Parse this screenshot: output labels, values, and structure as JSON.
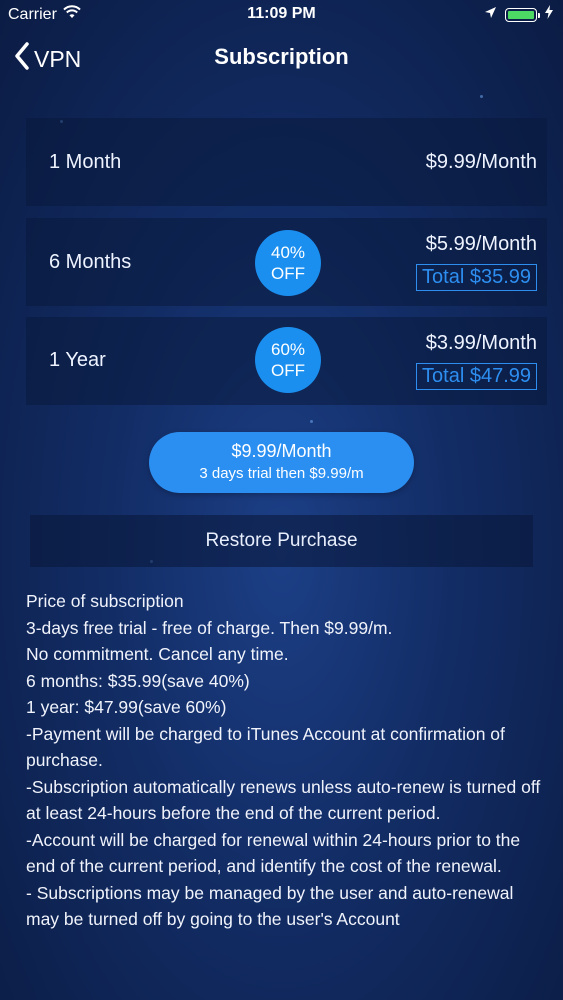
{
  "status_bar": {
    "carrier": "Carrier",
    "time": "11:09 PM"
  },
  "nav": {
    "back_label": "VPN",
    "title": "Subscription"
  },
  "plans": [
    {
      "label": "1 Month",
      "price": "$9.99/Month",
      "total": "",
      "badge_line1": "",
      "badge_line2": ""
    },
    {
      "label": "6 Months",
      "price": "$5.99/Month",
      "total": "Total $35.99",
      "badge_line1": "40%",
      "badge_line2": "OFF"
    },
    {
      "label": "1 Year",
      "price": "$3.99/Month",
      "total": "Total $47.99",
      "badge_line1": "60%",
      "badge_line2": "OFF"
    }
  ],
  "cta": {
    "main": "$9.99/Month",
    "sub": "3 days trial then $9.99/m"
  },
  "restore_label": "Restore Purchase",
  "terms": {
    "heading": "Price of subscription",
    "lines": [
      "3-days free trial - free of charge. Then $9.99/m.",
      "No commitment. Cancel any time.",
      "6 months: $35.99(save 40%)",
      "1 year: $47.99(save 60%)",
      "-Payment will be charged to iTunes Account at confirmation of purchase.",
      "-Subscription automatically renews unless auto-renew is turned off at least 24-hours before the end of the current period.",
      "-Account will be charged for renewal within 24-hours prior to the end of the current period, and identify the cost of the renewal.",
      "- Subscriptions may be managed by the user and auto-renewal may be turned off by going to the user's Account"
    ]
  },
  "colors": {
    "accent": "#2b8ff1",
    "background": "#122c64"
  }
}
